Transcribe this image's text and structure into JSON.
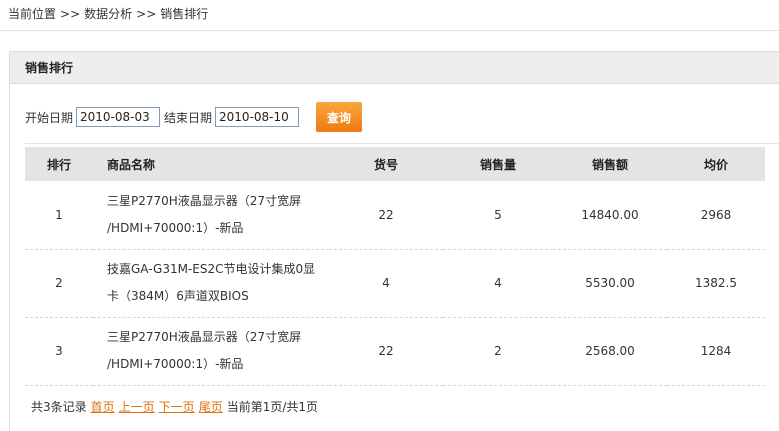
{
  "breadcrumb": {
    "items": [
      "当前位置",
      "数据分析",
      "销售排行"
    ],
    "separator": ">>"
  },
  "panel": {
    "title": "销售排行"
  },
  "filter": {
    "start_label": "开始日期",
    "start_value": "2010-08-03",
    "end_label": "结束日期",
    "end_value": "2010-08-10",
    "query_label": "查询",
    "query_color": "#f08c1e"
  },
  "table": {
    "headers": [
      "排行",
      "商品名称",
      "货号",
      "销售量",
      "销售额",
      "均价"
    ],
    "rows": [
      {
        "rank": "1",
        "name_line1": "三星P2770H液晶显示器（27寸宽屏",
        "name_line2": "/HDMI+70000:1）-新品",
        "sku": "22",
        "qty": "5",
        "amount": "14840.00",
        "avg": "2968"
      },
      {
        "rank": "2",
        "name_line1": "技嘉GA-G31M-ES2C节电设计集成0显",
        "name_line2": "卡（384M）6声道双BIOS",
        "sku": "4",
        "qty": "4",
        "amount": "5530.00",
        "avg": "1382.5"
      },
      {
        "rank": "3",
        "name_line1": "三星P2770H液晶显示器（27寸宽屏",
        "name_line2": "/HDMI+70000:1）-新品",
        "sku": "22",
        "qty": "2",
        "amount": "2568.00",
        "avg": "1284"
      }
    ]
  },
  "pager": {
    "total": "共3条记录",
    "first": "首页",
    "prev": "上一页",
    "next": "下一页",
    "last": "尾页",
    "info": "当前第1页/共1页",
    "link_color": "#e0700f"
  }
}
